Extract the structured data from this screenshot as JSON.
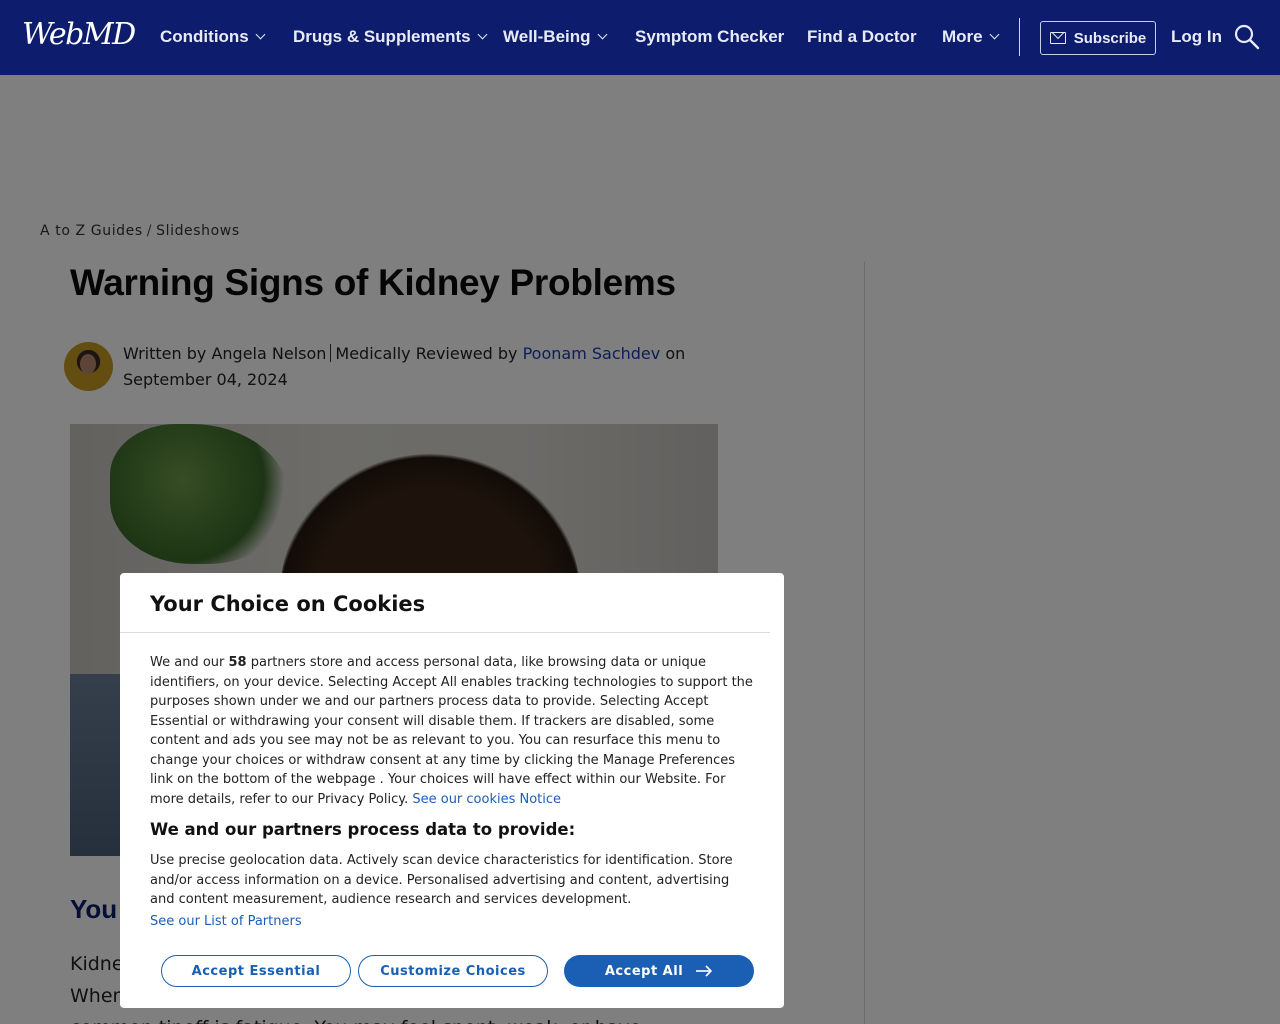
{
  "header": {
    "logo": "WebMD",
    "nav": [
      {
        "label": "Conditions"
      },
      {
        "label": "Drugs & Supplements"
      },
      {
        "label": "Well-Being"
      },
      {
        "label": "Symptom Checker"
      },
      {
        "label": "Find a Doctor"
      },
      {
        "label": "More"
      }
    ],
    "subscribe_label": "Subscribe",
    "login_label": "Log In"
  },
  "breadcrumb": {
    "items": [
      "A to Z Guides",
      "Slideshows"
    ],
    "separator": "/"
  },
  "article": {
    "title": "Warning Signs of Kidney Problems",
    "byline_written": "Written by Angela Nelson",
    "byline_reviewed_prefix": "Medically Reviewed by",
    "reviewer": "Poonam Sachdev",
    "byline_on": "on",
    "date": "September 04, 2024",
    "section_heading_visible": "You",
    "para_line1": "Kidne",
    "para_line2": "When",
    "para_line3": "common tipoff is fatigue. You may feel spent, weak, or have"
  },
  "cookie_modal": {
    "title": "Your Choice on Cookies",
    "body_1": "We and our",
    "partners_count": "58",
    "body_2": "partners store and access personal data, like browsing data or unique identifiers, on your device. Selecting Accept All      enables tracking technologies to support the purposes shown under we and our partners process data to provide. Selecting Accept Essential or withdrawing your consent will disable them. If trackers are disabled, some content and ads you see may not be as relevant to you. You can resurface this menu to change your choices or withdraw consent at any time by clicking the Manage Preferences link on the bottom of the webpage . Your choices will have effect within our Website. For more details, refer to our Privacy Policy.",
    "cookies_notice_link": "See our cookies Notice",
    "subheading": "We and our partners process data to provide:",
    "purposes": "Use precise geolocation data. Actively scan device characteristics for identification. Store and/or access information on a device. Personalised advertising and content, advertising and content measurement, audience research and services development.",
    "partners_link": "See our List of Partners",
    "btn_accept_essential": "Accept Essential",
    "btn_customize": "Customize Choices",
    "btn_accept_all": "Accept All"
  },
  "colors": {
    "header_bg": "#0d1c6c",
    "accent_blue": "#1a5fb4",
    "reviewer_link": "#1c3ab3"
  },
  "icons": [
    "chevron-down-icon",
    "mail-icon",
    "search-icon",
    "arrow-right-icon"
  ]
}
